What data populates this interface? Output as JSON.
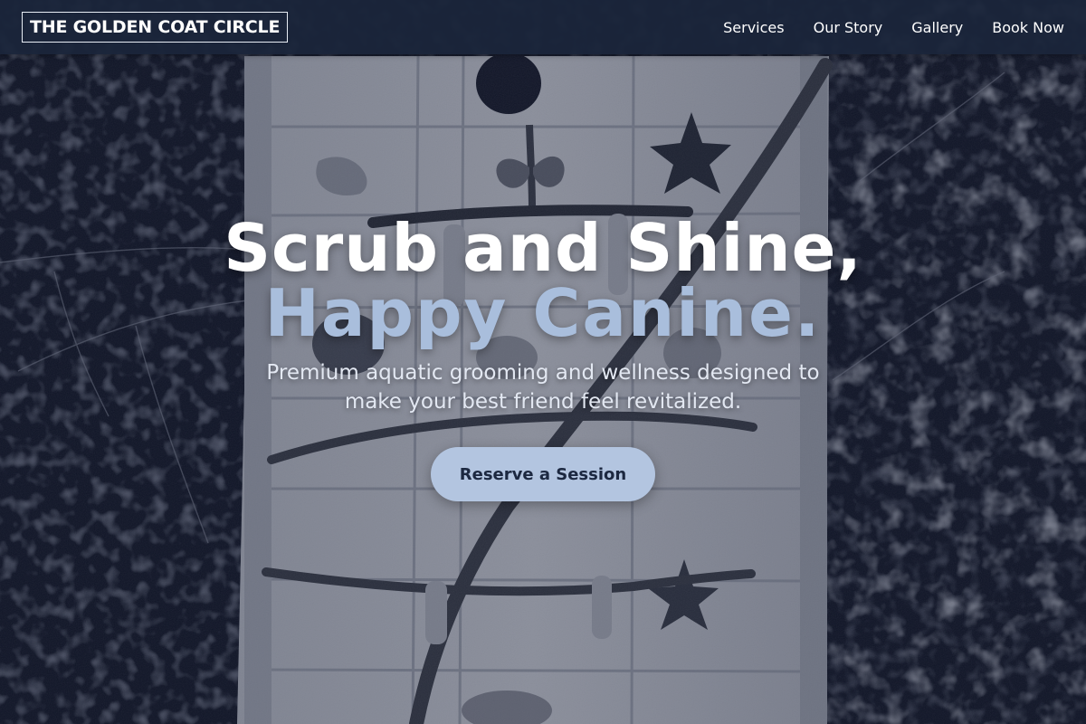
{
  "brand": {
    "logo_text": "THE GOLDEN COAT CIRCLE"
  },
  "nav": {
    "items": [
      {
        "label": "Services"
      },
      {
        "label": "Our Story"
      },
      {
        "label": "Gallery"
      },
      {
        "label": "Book Now"
      }
    ]
  },
  "hero": {
    "headline_line1": "Scrub and Shine,",
    "headline_line2": "Happy Canine.",
    "tagline": "Premium aquatic grooming and wellness designed to make your best friend feel revitalized.",
    "cta_label": "Reserve a Session"
  },
  "colors": {
    "navbar_bg": "#1b253a",
    "headline_accent": "#a9bedc",
    "cta_bg": "#b3c5e0",
    "cta_text": "#1c2840"
  }
}
